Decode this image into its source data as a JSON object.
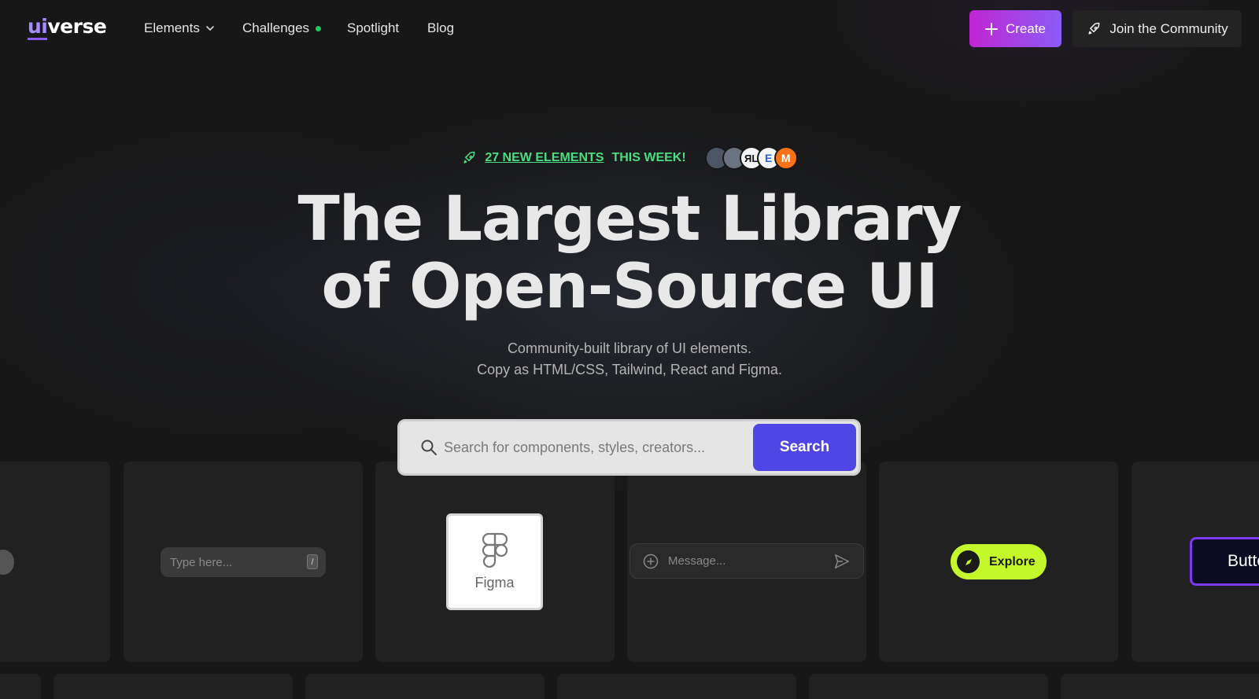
{
  "nav": {
    "logo_ui": "ui",
    "logo_verse": "verse",
    "items": [
      {
        "label": "Elements"
      },
      {
        "label": "Challenges"
      },
      {
        "label": "Spotlight"
      },
      {
        "label": "Blog"
      }
    ],
    "create_label": "Create",
    "join_label": "Join the Community"
  },
  "hero": {
    "announce_link": "27 NEW ELEMENTS",
    "announce_rest": "THIS WEEK!",
    "avatars": [
      {
        "letter": "",
        "color": "#4b5563"
      },
      {
        "letter": "",
        "color": "#6b7280"
      },
      {
        "letter": "ЯL",
        "color": "#e5e7eb"
      },
      {
        "letter": "Ε",
        "color": "#e5e7eb"
      },
      {
        "letter": "M",
        "color": "#f97316"
      }
    ],
    "title_line1": "The Largest Library",
    "title_line2": "of Open-Source UI",
    "subtitle_line1": "Community-built library of UI elements.",
    "subtitle_line2": "Copy as HTML/CSS, Tailwind, React and Figma."
  },
  "search": {
    "placeholder": "Search for components, styles, creators...",
    "button_label": "Search"
  },
  "cards": {
    "type_input_placeholder": "Type here...",
    "slash_key": "/",
    "figma_label": "Figma",
    "message_placeholder": "Message...",
    "explore_label": "Explore",
    "button_label": "Butto"
  },
  "colors": {
    "accent_gradient_start": "#c026d3",
    "accent_gradient_end": "#8b5cf6",
    "search_button": "#4f46e5",
    "announce_green": "#4ade80",
    "explore_lime": "#c4f82a"
  }
}
